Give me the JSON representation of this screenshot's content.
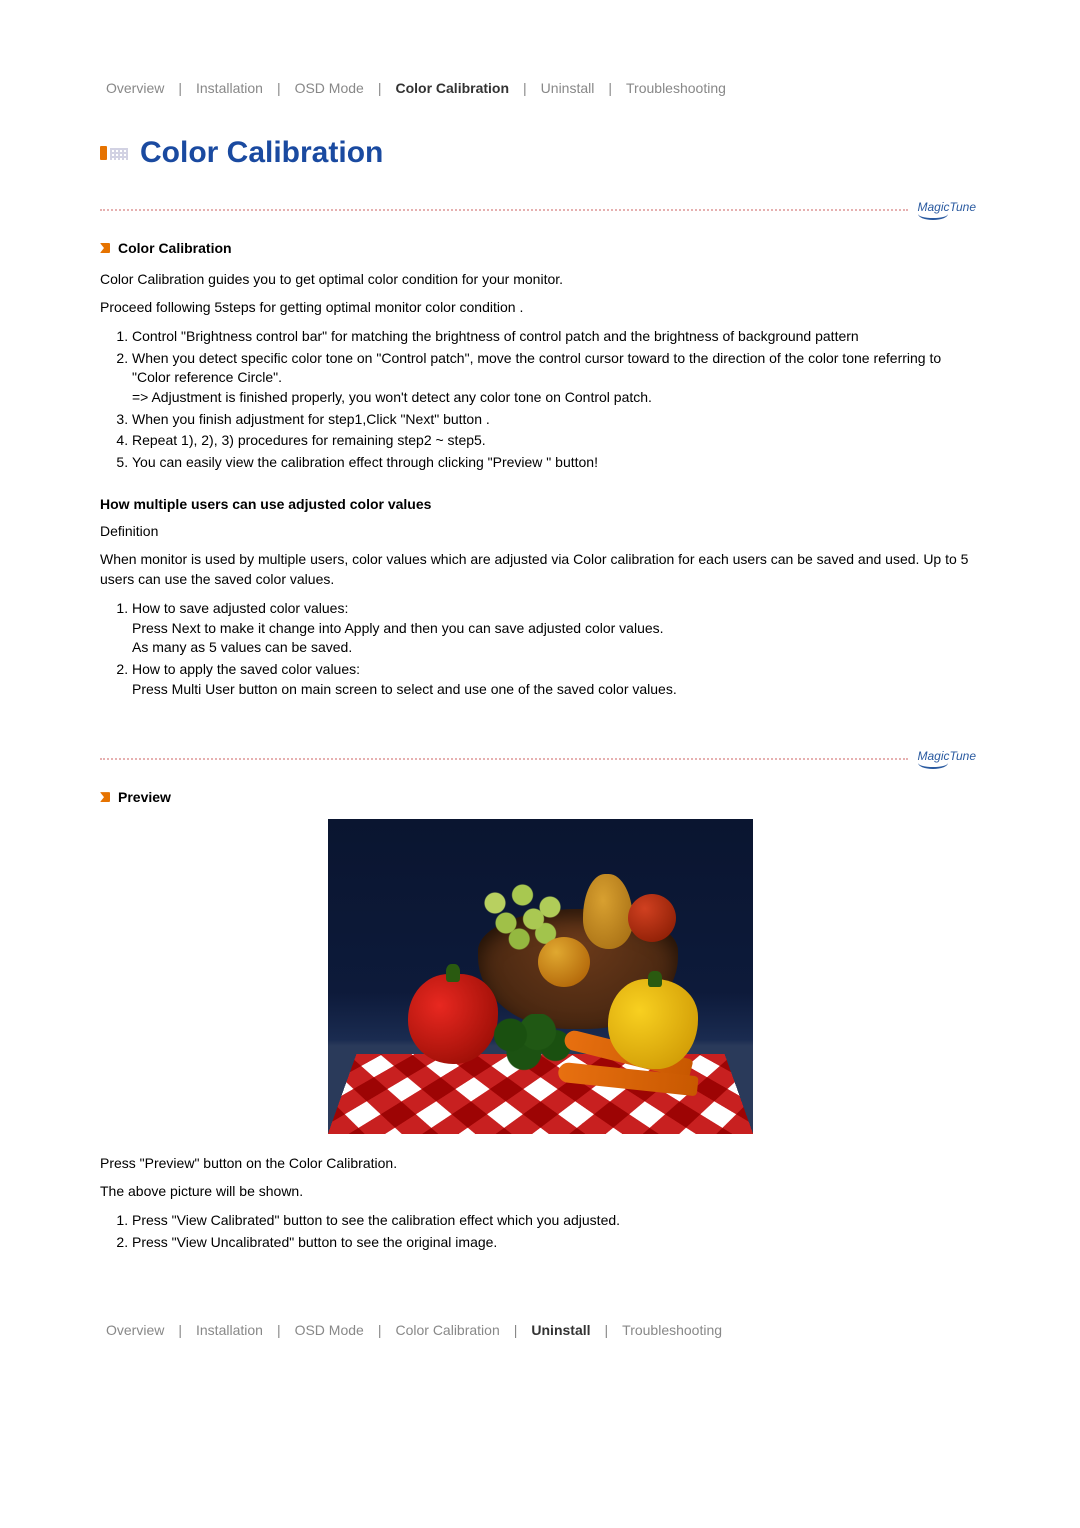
{
  "nav_top": {
    "items": [
      {
        "label": "Overview",
        "active": false
      },
      {
        "label": "Installation",
        "active": false
      },
      {
        "label": "OSD Mode",
        "active": false
      },
      {
        "label": "Color Calibration",
        "active": true
      },
      {
        "label": "Uninstall",
        "active": false
      },
      {
        "label": "Troubleshooting",
        "active": false
      }
    ]
  },
  "page_title": "Color Calibration",
  "logo_text": "MagicTune",
  "section_cc": {
    "heading": "Color Calibration",
    "intro1": "Color Calibration guides you to get optimal color condition for your monitor.",
    "intro2": "Proceed following 5steps for getting optimal monitor color condition .",
    "steps_a": [
      "Control \"Brightness control bar\" for matching the brightness of control patch and the brightness of background pattern",
      "When you detect specific color tone on \"Control patch\", move the control cursor toward to the direction of the color tone referring to \"Color reference Circle\".\n=> Adjustment is finished properly, you won't detect any color tone on Control patch.",
      "When you finish adjustment for step1,Click \"Next\" button .",
      "Repeat 1), 2), 3) procedures for remaining step2 ~ step5.",
      "You can easily view the calibration effect through clicking \"Preview \" button!"
    ],
    "subheading": "How multiple users can use adjusted color values",
    "definition_label": "Definition",
    "definition_body": "When monitor is used by multiple users, color values which are adjusted via Color calibration for each users can be saved and used. Up to 5 users can use the saved color values.",
    "steps_b": [
      "How to save adjusted color values:\nPress Next to make it change into Apply and then you can save adjusted color values.\nAs many as 5 values can be saved.",
      "How to apply the saved color values:\nPress Multi User button on main screen to select and use one of the saved color values."
    ]
  },
  "section_preview": {
    "heading": "Preview",
    "after_text1": "Press \"Preview\" button on the Color Calibration.",
    "after_text2": "The above picture will be shown.",
    "steps": [
      "Press \"View Calibrated\" button to see the calibration effect which you adjusted.",
      "Press \"View Uncalibrated\" button to see the original image."
    ]
  },
  "nav_bottom": {
    "items": [
      {
        "label": "Overview",
        "active": false
      },
      {
        "label": "Installation",
        "active": false
      },
      {
        "label": "OSD Mode",
        "active": false
      },
      {
        "label": "Color Calibration",
        "active": false
      },
      {
        "label": "Uninstall",
        "active": true
      },
      {
        "label": "Troubleshooting",
        "active": false
      }
    ]
  }
}
